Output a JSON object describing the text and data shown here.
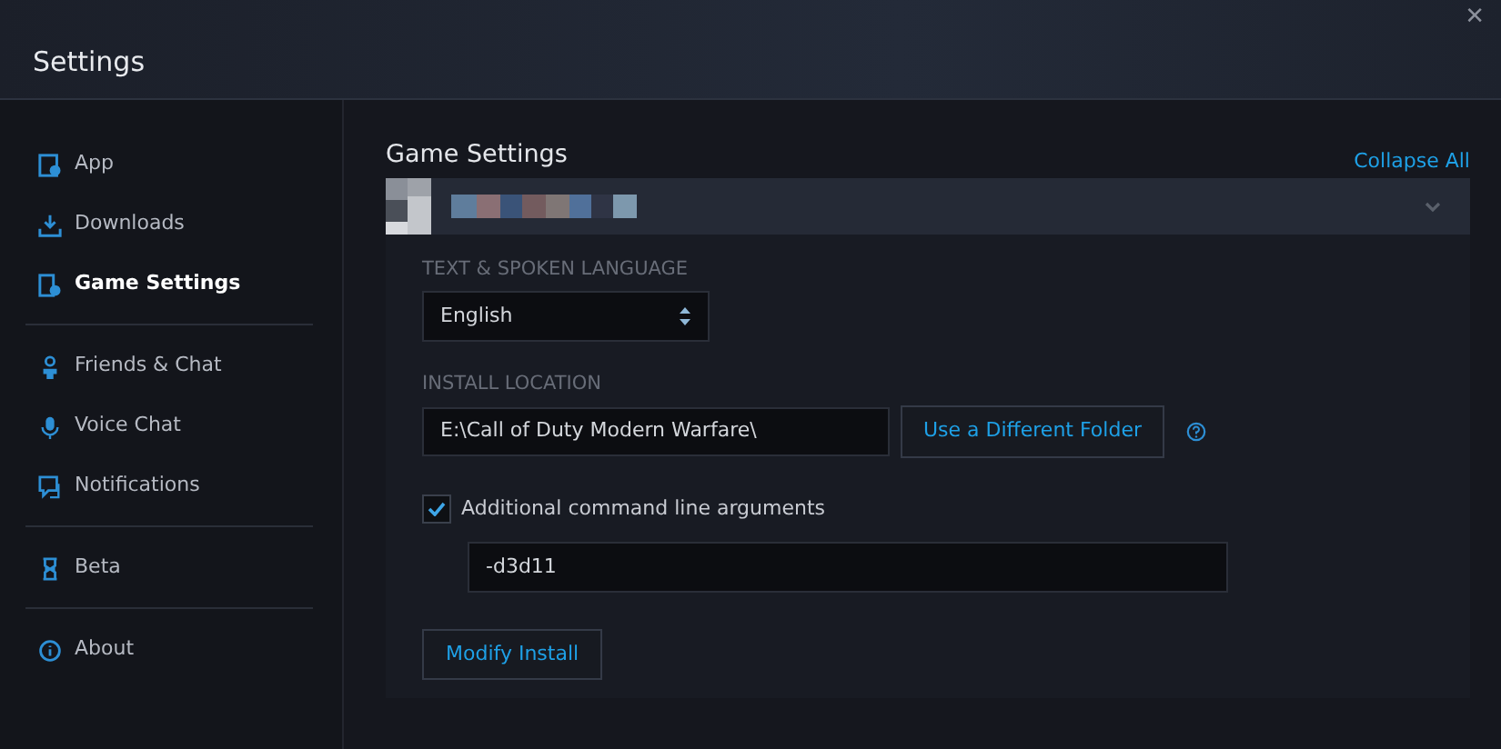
{
  "window": {
    "title": "Settings",
    "close": "✕"
  },
  "sidebar": {
    "groups": [
      [
        {
          "label": "App",
          "kind": "app",
          "selected": false
        },
        {
          "label": "Downloads",
          "kind": "download",
          "selected": false
        },
        {
          "label": "Game Settings",
          "kind": "game",
          "selected": true
        }
      ],
      [
        {
          "label": "Friends & Chat",
          "kind": "friends",
          "selected": false
        },
        {
          "label": "Voice Chat",
          "kind": "mic",
          "selected": false
        },
        {
          "label": "Notifications",
          "kind": "notify",
          "selected": false
        }
      ],
      [
        {
          "label": "Beta",
          "kind": "beta",
          "selected": false
        }
      ],
      [
        {
          "label": "About",
          "kind": "info",
          "selected": false
        }
      ]
    ]
  },
  "main": {
    "heading": "Game Settings",
    "collapse_link": "Collapse All",
    "game": {
      "expanded": true
    },
    "language": {
      "label": "TEXT & SPOKEN LANGUAGE",
      "value": "English"
    },
    "install": {
      "label": "INSTALL LOCATION",
      "value": "E:\\Call of Duty Modern Warfare\\",
      "button": "Use a Different Folder"
    },
    "arguments": {
      "label": "Additional command line arguments",
      "checked": true,
      "value": "-d3d11"
    },
    "modify_button": "Modify Install"
  }
}
